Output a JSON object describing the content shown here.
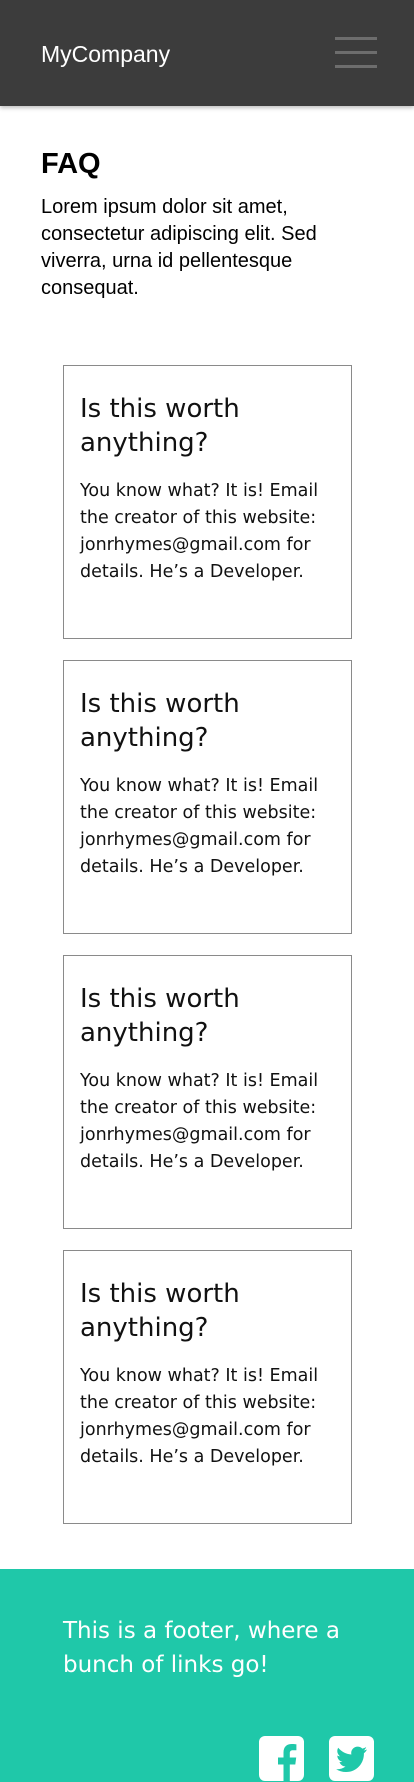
{
  "header": {
    "brand": "MyCompany",
    "menu_icon": "hamburger-menu-icon"
  },
  "intro": {
    "title": "FAQ",
    "text": "Lorem ipsum dolor sit amet, consectetur adipiscing elit. Sed viverra, urna id pellentesque consequat."
  },
  "faqs": [
    {
      "question": "Is this worth anything?",
      "answer": "You know what? It is! Email the creator of this website: jonrhymes@gmail.com for details. He’s a Developer."
    },
    {
      "question": "Is this worth anything?",
      "answer": "You know what? It is! Email the creator of this website: jonrhymes@gmail.com for details. He’s a Developer."
    },
    {
      "question": "Is this worth anything?",
      "answer": "You know what? It is! Email the creator of this website: jonrhymes@gmail.com for details. He’s a Developer."
    },
    {
      "question": "Is this worth anything?",
      "answer": "You know what? It is! Email the creator of this website: jonrhymes@gmail.com for details. He’s a Developer."
    }
  ],
  "footer": {
    "text": "This is a footer, where a bunch of links go!",
    "social": [
      {
        "icon": "facebook-icon"
      },
      {
        "icon": "twitter-icon"
      }
    ]
  },
  "colors": {
    "header_bg": "#3c3c3c",
    "footer_bg": "#1fc8a9",
    "card_border": "#8a8a8a"
  }
}
